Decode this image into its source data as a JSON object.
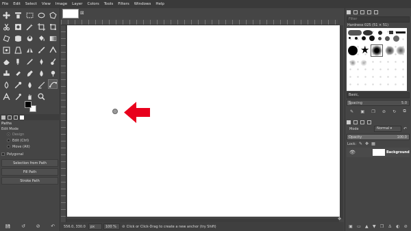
{
  "menu": [
    "File",
    "Edit",
    "Select",
    "View",
    "Image",
    "Layer",
    "Colors",
    "Tools",
    "Filters",
    "Windows",
    "Help"
  ],
  "tool_options": {
    "tab_title": "Paths",
    "edit_mode_label": "Edit Mode",
    "modes": [
      "Design",
      "Edit (Ctrl)",
      "Move (Alt)"
    ],
    "selected_mode": "Design",
    "polygonal_label": "Polygonal",
    "buttons": [
      "Selection from Path",
      "Fill Path",
      "Stroke Path"
    ]
  },
  "brushes": {
    "filter_placeholder": "Filter",
    "current_brush": "Hardness 025 (51 × 51)",
    "tag_label": "Basic,",
    "spacing_label": "Spacing",
    "spacing_value": "5.0"
  },
  "layers": {
    "mode_label": "Mode",
    "mode_value": "Normal",
    "opacity_label": "Opacity",
    "opacity_value": "100.0",
    "lock_label": "Lock:",
    "layer_name": "Background"
  },
  "status": {
    "coordinates": "556.0, 330.0",
    "unit": "px",
    "zoom": "100 %",
    "message": "Click or Click-Drag to create a new anchor (try Shift)"
  },
  "colors": {
    "accent_arrow": "#e8001c",
    "canvas": "#ffffff",
    "background": "#454545"
  }
}
